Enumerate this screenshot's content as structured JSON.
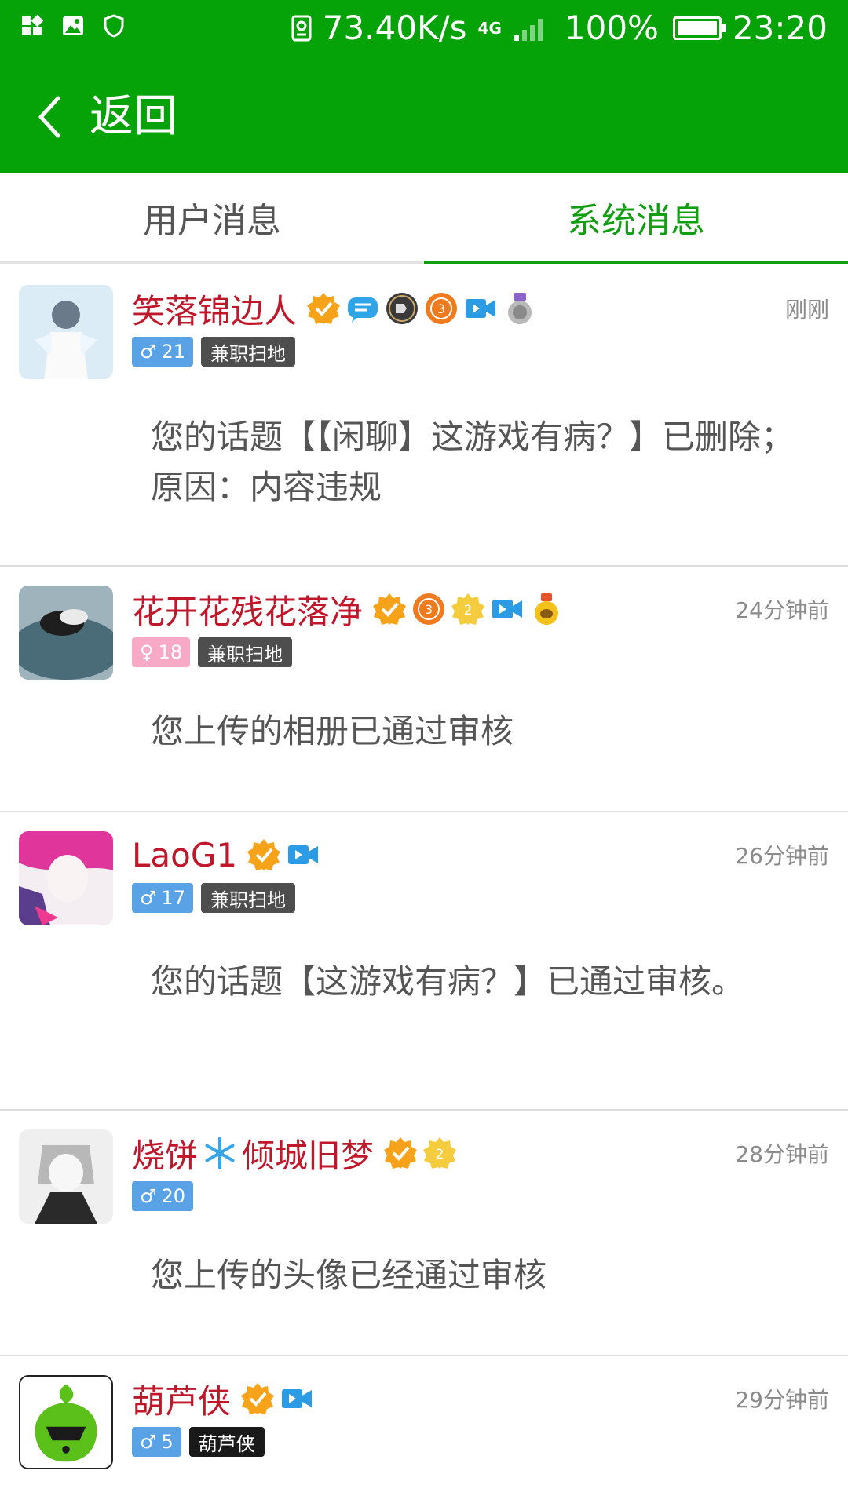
{
  "status_bar": {
    "speed": "73.40K/s",
    "network": "4G",
    "battery": "100%",
    "time": "23:20",
    "battery_level": 1.0
  },
  "header": {
    "back_label": "返回"
  },
  "tabs": [
    {
      "label": "用户消息",
      "active": false
    },
    {
      "label": "系统消息",
      "active": true
    }
  ],
  "messages": [
    {
      "name": "笑落锦边人",
      "gender": "♂",
      "level": "21",
      "role": "兼职扫地",
      "time": "刚刚",
      "text": "您的话题【【闲聊】这游戏有病？】已删除；原因：内容违规"
    },
    {
      "name": "花开花残花落净",
      "gender": "♀",
      "level": "18",
      "role": "兼职扫地",
      "time": "24分钟前",
      "text": "您上传的相册已通过审核"
    },
    {
      "name": "LaoG1",
      "gender": "♂",
      "level": "17",
      "role": "兼职扫地",
      "time": "26分钟前",
      "text": "您的话题【这游戏有病？】已通过审核。"
    },
    {
      "name_a": "烧饼",
      "name_b": "倾城旧梦",
      "gender": "♂",
      "level": "20",
      "time": "28分钟前",
      "text": "您上传的头像已经通过审核"
    },
    {
      "name": "葫芦侠",
      "gender": "♂",
      "level": "5",
      "role": "葫芦侠",
      "time": "29分钟前"
    }
  ],
  "colors": {
    "primary_green": "#05a208",
    "tab_active": "#119e11",
    "username_red": "#c0172b",
    "male_badge": "#5aa2e6",
    "female_badge": "#f7a9c6",
    "role_badge": "#4e4e4e"
  }
}
